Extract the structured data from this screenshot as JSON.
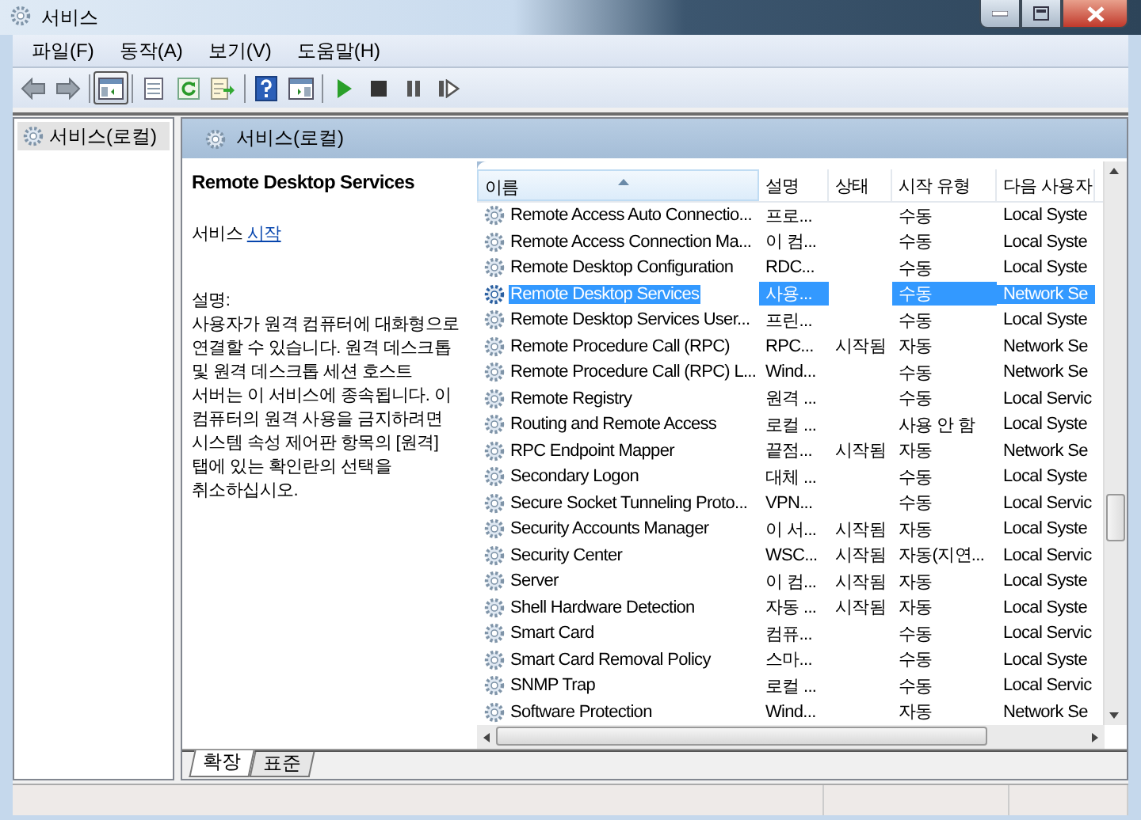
{
  "window": {
    "title": "서비스"
  },
  "menu": [
    "파일(F)",
    "동작(A)",
    "보기(V)",
    "도움말(H)"
  ],
  "toolbar": [
    {
      "kind": "back",
      "pressed": false
    },
    {
      "kind": "forward",
      "pressed": false
    },
    {
      "kind": "sep"
    },
    {
      "kind": "tree",
      "pressed": true
    },
    {
      "kind": "sep"
    },
    {
      "kind": "list",
      "pressed": false
    },
    {
      "kind": "refresh",
      "pressed": false
    },
    {
      "kind": "export",
      "pressed": false
    },
    {
      "kind": "sep"
    },
    {
      "kind": "help",
      "pressed": false
    },
    {
      "kind": "pane",
      "pressed": false
    },
    {
      "kind": "sep"
    },
    {
      "kind": "play",
      "pressed": false
    },
    {
      "kind": "stop",
      "pressed": false
    },
    {
      "kind": "pause",
      "pressed": false
    },
    {
      "kind": "restart",
      "pressed": false
    }
  ],
  "tree": {
    "items": [
      {
        "label": "서비스(로컬)",
        "selected": true
      }
    ]
  },
  "panel": {
    "title": "서비스(로컬)"
  },
  "details": {
    "title": "Remote Desktop Services",
    "action_prefix": "서비스",
    "action_link": "시작",
    "description_label": "설명:",
    "description": "사용자가 원격 컴퓨터에 대화형으로 연결할 수 있습니다. 원격 데스크톱 및 원격 데스크톱 세션 호스트 서버는 이 서비스에 종속됩니다. 이 컴퓨터의 원격 사용을 금지하려면 시스템 속성 제어판 항목의 [원격] 탭에 있는 확인란의 선택을 취소하십시오."
  },
  "table": {
    "columns": [
      {
        "label": "이름",
        "sorted": true
      },
      {
        "label": "설명",
        "sorted": false
      },
      {
        "label": "상태",
        "sorted": false
      },
      {
        "label": "시작 유형",
        "sorted": false
      },
      {
        "label": "다음 사용자",
        "sorted": false
      }
    ],
    "rows": [
      {
        "cells": [
          "Remote Access Auto Connectio...",
          "프로...",
          "",
          "수동",
          "Local Syste"
        ],
        "selected": false
      },
      {
        "cells": [
          "Remote Access Connection Ma...",
          "이 컴...",
          "",
          "수동",
          "Local Syste"
        ],
        "selected": false
      },
      {
        "cells": [
          "Remote Desktop Configuration",
          "RDC...",
          "",
          "수동",
          "Local Syste"
        ],
        "selected": false
      },
      {
        "cells": [
          "Remote Desktop Services",
          "사용...",
          "",
          "수동",
          "Network Se"
        ],
        "selected": true
      },
      {
        "cells": [
          "Remote Desktop Services User...",
          "프린...",
          "",
          "수동",
          "Local Syste"
        ],
        "selected": false
      },
      {
        "cells": [
          "Remote Procedure Call (RPC)",
          "RPC...",
          "시작됨",
          "자동",
          "Network Se"
        ],
        "selected": false
      },
      {
        "cells": [
          "Remote Procedure Call (RPC) L...",
          "Wind...",
          "",
          "수동",
          "Network Se"
        ],
        "selected": false
      },
      {
        "cells": [
          "Remote Registry",
          "원격 ...",
          "",
          "수동",
          "Local Servic"
        ],
        "selected": false
      },
      {
        "cells": [
          "Routing and Remote Access",
          "로컬 ...",
          "",
          "사용 안 함",
          "Local Syste"
        ],
        "selected": false
      },
      {
        "cells": [
          "RPC Endpoint Mapper",
          "끝점...",
          "시작됨",
          "자동",
          "Network Se"
        ],
        "selected": false
      },
      {
        "cells": [
          "Secondary Logon",
          "대체 ...",
          "",
          "수동",
          "Local Syste"
        ],
        "selected": false
      },
      {
        "cells": [
          "Secure Socket Tunneling Proto...",
          "VPN...",
          "",
          "수동",
          "Local Servic"
        ],
        "selected": false
      },
      {
        "cells": [
          "Security Accounts Manager",
          "이 서...",
          "시작됨",
          "자동",
          "Local Syste"
        ],
        "selected": false
      },
      {
        "cells": [
          "Security Center",
          "WSC...",
          "시작됨",
          "자동(지연...",
          "Local Servic"
        ],
        "selected": false
      },
      {
        "cells": [
          "Server",
          "이 컴...",
          "시작됨",
          "자동",
          "Local Syste"
        ],
        "selected": false
      },
      {
        "cells": [
          "Shell Hardware Detection",
          "자동 ...",
          "시작됨",
          "자동",
          "Local Syste"
        ],
        "selected": false
      },
      {
        "cells": [
          "Smart Card",
          "컴퓨...",
          "",
          "수동",
          "Local Servic"
        ],
        "selected": false
      },
      {
        "cells": [
          "Smart Card Removal Policy",
          "스마...",
          "",
          "수동",
          "Local Syste"
        ],
        "selected": false
      },
      {
        "cells": [
          "SNMP Trap",
          "로컬 ...",
          "",
          "수동",
          "Local Servic"
        ],
        "selected": false
      },
      {
        "cells": [
          "Software Protection",
          "Wind...",
          "",
          "자동",
          "Network Se"
        ],
        "selected": false
      }
    ]
  },
  "tabs": [
    {
      "label": "확장",
      "selected": true
    },
    {
      "label": "표준",
      "selected": false
    }
  ]
}
